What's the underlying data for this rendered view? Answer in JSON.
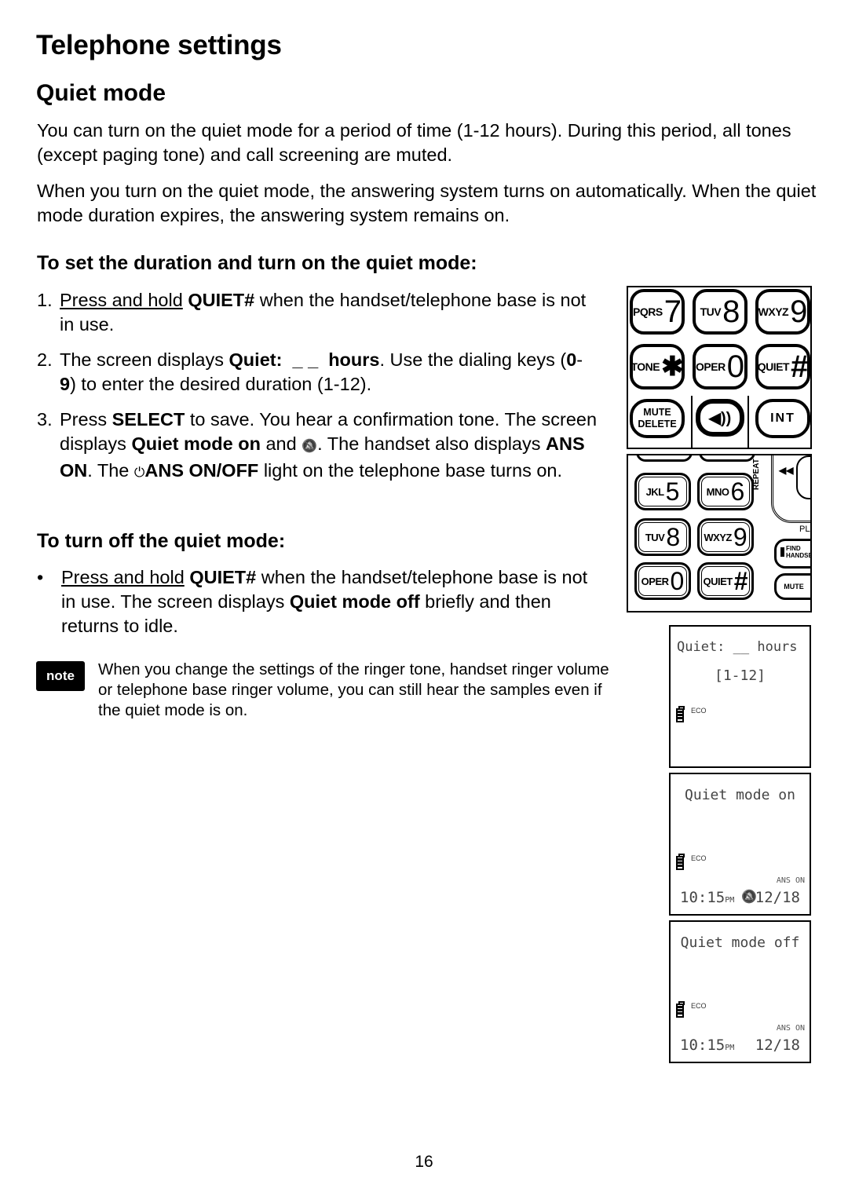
{
  "page": {
    "title": "Telephone settings",
    "section_title": "Quiet mode",
    "intro": [
      "You can turn on the quiet mode for a period of time (1-12 hours). During this period, all tones (except paging tone) and call screening are muted.",
      "When you turn on the quiet mode, the answering system turns on automatically. When the quiet mode duration expires, the answering system remains on."
    ],
    "page_number": "16"
  },
  "set_section": {
    "heading": "To set the duration and turn on the quiet mode:",
    "steps": [
      {
        "num": "1.",
        "underline": "Press and hold",
        "bold1": "QUIET#",
        "text1": " when the handset/telephone base is not in use."
      },
      {
        "num": "2.",
        "text0": "The screen displays ",
        "bold1": "Quiet:  _ _  hours",
        "text1": ". Use the dialing keys (",
        "bold2": "0",
        "text2": "-",
        "bold3": "9",
        "text3": ") to enter the desired duration (1-12)."
      },
      {
        "num": "3.",
        "text0": "Press ",
        "bold1": "SELECT",
        "text1": " to save. You hear a confirmation tone. The screen displays ",
        "bold2": "Quiet mode on",
        "text2": " and ",
        "icon": "🔕",
        "text3": ". The handset also displays ",
        "bold3": "ANS ON",
        "text4": ". The ",
        "power_icon": "⏻",
        "bold4": "ANS ON/OFF",
        "text5": " light on the telephone base turns on."
      }
    ]
  },
  "off_section": {
    "heading": "To turn off the quiet mode:",
    "bullet": "•",
    "underline": "Press and hold",
    "bold1": "QUIET#",
    "text1": " when the handset/telephone base is not in use. The screen displays ",
    "bold2": "Quiet mode off",
    "text2": " briefly and then returns to idle."
  },
  "note": {
    "badge": "note",
    "text": "When you change the settings of the ringer tone, handset ringer volume or telephone base ringer volume, you can still hear the samples even if the quiet mode is on."
  },
  "handset_keypad": {
    "keys": [
      {
        "letters": "PQRS",
        "digit": "7"
      },
      {
        "letters": "TUV",
        "digit": "8"
      },
      {
        "letters": "WXYZ",
        "digit": "9"
      },
      {
        "letters": "TONE",
        "digit": "✱"
      },
      {
        "letters": "OPER",
        "digit": "0"
      },
      {
        "letters": "QUIET",
        "digit": "#"
      },
      {
        "line1": "MUTE",
        "line2": "DELETE"
      },
      {
        "icon": "speaker-icon",
        "glyph": "◀))"
      },
      {
        "label": "INT"
      }
    ]
  },
  "base_keypad": {
    "keys": [
      {
        "letters": "JKL",
        "digit": "5"
      },
      {
        "letters": "MNO",
        "digit": "6"
      },
      {
        "letters": "TUV",
        "digit": "8"
      },
      {
        "letters": "WXYZ",
        "digit": "9"
      },
      {
        "letters": "OPER",
        "digit": "0"
      },
      {
        "letters": "QUIET",
        "digit": "#"
      }
    ],
    "repeat_label": "REPEAT",
    "rewind_glyph": "◀◀",
    "play_label": "PLA",
    "find_label_1": "FIND",
    "find_label_2": "HANDSET",
    "mute_label": "MUTE"
  },
  "screens": [
    {
      "line1": "Quiet: __ hours",
      "line2": "[1-12]",
      "eco": "ECO"
    },
    {
      "line1": "Quiet mode on",
      "eco": "ECO",
      "ans": "ANS ON",
      "time": "10:15",
      "ampm": "PM",
      "bell": "🔕",
      "date": "12/18"
    },
    {
      "line1": "Quiet mode off",
      "eco": "ECO",
      "ans": "ANS ON",
      "time": "10:15",
      "ampm": "PM",
      "date": "12/18"
    }
  ]
}
